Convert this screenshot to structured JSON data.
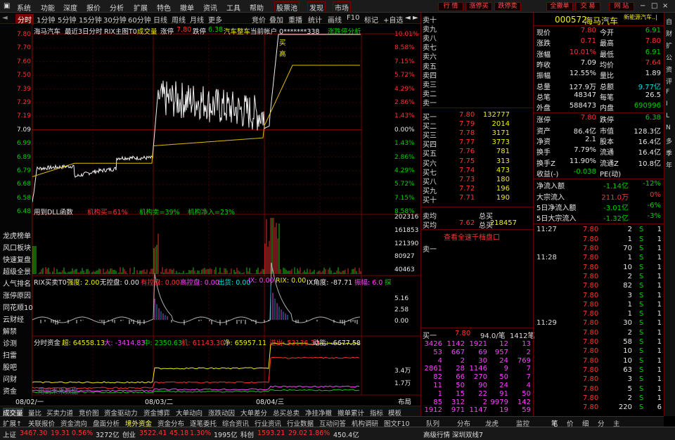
{
  "menu": {
    "items": [
      "系统",
      "功能",
      "深度",
      "报价",
      "分析",
      "扩展",
      "特色",
      "撤单",
      "资讯",
      "工具",
      "帮助"
    ],
    "stock_pool": "股票池",
    "discover": "发现",
    "market": "市场",
    "buttons": [
      "行 情",
      "涨停买",
      "跌停卖",
      "全撤单",
      "交 易",
      "网 站"
    ],
    "win_controls": [
      "−",
      "□",
      "×"
    ]
  },
  "period": {
    "active": "分时",
    "items": [
      "1分钟",
      "5分钟",
      "15分钟",
      "30分钟",
      "60分钟",
      "日线",
      "周线",
      "月线",
      "更多"
    ],
    "right": [
      "竞价",
      "叠加",
      "重播",
      "统计",
      "画线",
      "F10",
      "标记",
      "+自选",
      "◄",
      "►"
    ]
  },
  "chart_header": {
    "name": "海马汽车",
    "desc": "最近3日分时",
    "indicator": "RIX主图T0",
    "vol_label": "成交量",
    "rise_label": "涨停",
    "rise": "7.80",
    "fall_label": "跌停",
    "fall": "6.38",
    "board": "汽车整车",
    "account": "当前帐户 0*******338",
    "analysis": "涨跌停分析"
  },
  "price_axis": [
    "7.80",
    "7.70",
    "7.60",
    "7.50",
    "7.39",
    "7.29",
    "7.19",
    "7.09",
    "6.99",
    "6.89",
    "6.79",
    "6.68",
    "6.58",
    "6.48"
  ],
  "pct_axis": [
    "10.01%",
    "8.58%",
    "7.15%",
    "5.72%",
    "4.29%",
    "2.86%",
    "1.43%",
    "0.00%",
    "1.43%",
    "2.86%",
    "4.29%",
    "5.72%",
    "7.15%",
    "8.58%"
  ],
  "markers": {
    "buy": "买",
    "high": "高"
  },
  "dll": {
    "label": "用到DLL函数",
    "a": "机构买=61%",
    "b": "机构卖=39%",
    "c": "机构净入=23%"
  },
  "vol_axis": [
    "202316",
    "161853",
    "121390",
    "80927",
    "40463"
  ],
  "rix": {
    "label": "RIX买卖T0",
    "strength": "强度: 2.00",
    "no_ctrl": "无控盘: 0.00",
    "ctrl": "有控盘: 0.00",
    "high_ctrl": "高控盘: 0.00",
    "out": "出货: 0.00",
    "ix": "IX: 0.00",
    "rix": "RIX: 0.00",
    "angle": "IX角度: -87.71",
    "amp": "振幅: 6.0",
    "extra": "探"
  },
  "rix_axis": [
    "5.16",
    "2.58",
    "0.00"
  ],
  "fund": {
    "label": "分时资金",
    "super": "超: 64558.13",
    "big": "大: -3414.83",
    "mid": "中: 2350.63",
    "small": "机: 61143.30",
    "net": "净: 65957.11",
    "out": "进出: 53136.30",
    "mom": "动能: -6677.58"
  },
  "fund_axis": [
    "3.4万",
    "1.7万"
  ],
  "watermark": "用到未来数据",
  "dates": [
    "08/02/一",
    "08/03/二",
    "08/04/三"
  ],
  "layout_label": "布局",
  "left_nav": [
    "龙虎榜单",
    "风口板块",
    "快速复盘",
    "超级全景",
    "人气排名",
    "涨停原因",
    "同花顺10",
    "云财经",
    "解禁",
    "诊测",
    "扫雷",
    "股吧",
    "问财",
    "资金"
  ],
  "tabs1": [
    "成交量",
    "量比",
    "买卖力道",
    "竞价图",
    "资金驱动力",
    "资金博弈",
    "大单动向",
    "涨跌动因",
    "大单差分",
    "总买总卖",
    "净挂净撤",
    "撤单累计",
    "指标",
    "模板"
  ],
  "tabs2": [
    "扩展↑",
    "关联报价",
    "资金流向",
    "盘面分析",
    "境外资金",
    "资金分布",
    "逐笔委托",
    "综合资讯",
    "行业资讯",
    "行业数据",
    "互动问答",
    "机构调研",
    "图文F10",
    "侧边栏"
  ],
  "orderbook": {
    "sells": [
      "卖十",
      "卖九",
      "卖八",
      "卖七",
      "卖六",
      "卖五",
      "卖四",
      "卖三",
      "卖二",
      "卖一"
    ],
    "buys": [
      {
        "label": "买一",
        "price": "7.80",
        "vol": "132777"
      },
      {
        "label": "买二",
        "price": "7.79",
        "vol": "2014"
      },
      {
        "label": "买三",
        "price": "7.78",
        "vol": "3171"
      },
      {
        "label": "买四",
        "price": "7.77",
        "vol": "3773"
      },
      {
        "label": "买五",
        "price": "7.76",
        "vol": "781"
      },
      {
        "label": "买六",
        "price": "7.75",
        "vol": "313"
      },
      {
        "label": "买七",
        "price": "7.74",
        "vol": "473"
      },
      {
        "label": "买八",
        "price": "7.73",
        "vol": "180"
      },
      {
        "label": "买九",
        "price": "7.72",
        "vol": "196"
      },
      {
        "label": "买十",
        "price": "7.71",
        "vol": "190"
      }
    ],
    "avg": "卖均",
    "total": "总买",
    "buy_avg_label": "买均",
    "buy_avg": "7.62",
    "total_buy_label": "总买",
    "total_buy": "218457",
    "view_link": "查看全速千档盘口",
    "sell1": "卖一",
    "buy1": "买一",
    "buy1_price": "7.80",
    "buy1_lot": "94.0/笔",
    "buy1_cnt": "1412笔",
    "queue": [
      [
        "3426",
        "1142",
        "1921",
        "12",
        "13"
      ],
      [
        "53",
        "667",
        "69",
        "957",
        "2"
      ],
      [
        "4",
        "2",
        "30",
        "24",
        "769"
      ],
      [
        "2861",
        "28",
        "1146",
        "9",
        "7"
      ],
      [
        "82",
        "66",
        "270",
        "50",
        "7"
      ],
      [
        "11",
        "50",
        "90",
        "24",
        "4"
      ],
      [
        "1",
        "15",
        "22",
        "91",
        "50"
      ],
      [
        "85",
        "312",
        "2",
        "9979",
        "142"
      ],
      [
        "1912",
        "971",
        "1147",
        "19",
        "59"
      ]
    ]
  },
  "quote": {
    "code": "000572",
    "name": "海马汽车",
    "title_tag": "新能源汽车..|",
    "rows": [
      [
        "现价",
        "7.80",
        "今开",
        "6.91"
      ],
      [
        "涨跌",
        "0.71",
        "最高",
        "7.80"
      ],
      [
        "涨幅",
        "10.01%",
        "最低",
        "6.91"
      ],
      [
        "昨收",
        "7.09",
        "均价",
        "7.64"
      ],
      [
        "振幅",
        "12.55%",
        "量比",
        "1.89"
      ],
      [
        "总量",
        "127.9万",
        "总额",
        "9.77亿"
      ],
      [
        "总笔",
        "48347",
        "每笔",
        "26.5"
      ],
      [
        "外盘",
        "588473",
        "内盘",
        "690996"
      ]
    ],
    "rows2": [
      [
        "涨停",
        "7.80",
        "跌停",
        "6.38"
      ],
      [
        "资产",
        "86.4亿",
        "市值",
        "128.3亿"
      ],
      [
        "净资",
        "2.1",
        "股本",
        "16.4亿"
      ],
      [
        "换手",
        "7.79%",
        "流通",
        "16.4亿"
      ],
      [
        "换手Z",
        "11.90%",
        "流通Z",
        "10.8亿"
      ],
      [
        "收益(-)",
        "-0.038",
        "PE(动)",
        ""
      ]
    ],
    "flows": [
      [
        "净流入额",
        "-1.14亿",
        "-12%"
      ],
      [
        "大宗流入",
        "211.0万",
        "0%"
      ],
      [
        "5日净流入额",
        "-3.01亿",
        "-6%"
      ],
      [
        "5日大宗流入",
        "-1.32亿",
        "-3%"
      ]
    ]
  },
  "ticks": [
    {
      "t": "11:27",
      "p": "7.80",
      "v": "2",
      "s": "S",
      "n": "1"
    },
    {
      "t": "",
      "p": "7.80",
      "v": "1",
      "s": "S",
      "n": "1"
    },
    {
      "t": "",
      "p": "7.80",
      "v": "70",
      "s": "S",
      "n": "1"
    },
    {
      "t": "11:28",
      "p": "7.80",
      "v": "1",
      "s": "S",
      "n": "1"
    },
    {
      "t": "",
      "p": "7.80",
      "v": "10",
      "s": "S",
      "n": "1"
    },
    {
      "t": "",
      "p": "7.80",
      "v": "2",
      "s": "S",
      "n": "1"
    },
    {
      "t": "",
      "p": "7.80",
      "v": "82",
      "s": "S",
      "n": "1"
    },
    {
      "t": "",
      "p": "7.80",
      "v": "3",
      "s": "S",
      "n": "1"
    },
    {
      "t": "",
      "p": "7.80",
      "v": "1",
      "s": "S",
      "n": "1"
    },
    {
      "t": "",
      "p": "7.80",
      "v": "1",
      "s": "S",
      "n": "1"
    },
    {
      "t": "11:29",
      "p": "7.80",
      "v": "30",
      "s": "S",
      "n": "1"
    },
    {
      "t": "",
      "p": "7.80",
      "v": "2",
      "s": "S",
      "n": "1"
    },
    {
      "t": "",
      "p": "7.80",
      "v": "58",
      "s": "S",
      "n": "1"
    },
    {
      "t": "",
      "p": "7.80",
      "v": "10",
      "s": "S",
      "n": "1"
    },
    {
      "t": "",
      "p": "7.80",
      "v": "10",
      "s": "S",
      "n": "1"
    },
    {
      "t": "",
      "p": "7.80",
      "v": "63",
      "s": "S",
      "n": "1"
    },
    {
      "t": "",
      "p": "7.80",
      "v": "3",
      "s": "S",
      "n": "1"
    },
    {
      "t": "",
      "p": "7.80",
      "v": "5",
      "s": "S",
      "n": "1"
    },
    {
      "t": "",
      "p": "7.80",
      "v": "2",
      "s": "S",
      "n": "1"
    },
    {
      "t": "",
      "p": "7.80",
      "v": "220",
      "s": "S",
      "n": "6"
    }
  ],
  "rtabs": [
    "队列",
    "分布",
    "龙虎",
    "监控",
    "笔",
    "价",
    "细",
    "分",
    "主"
  ],
  "vtabs": [
    "自",
    "财",
    "扩",
    "公",
    "资",
    "评",
    "F",
    "I",
    "L",
    "N",
    "多",
    "季",
    "年"
  ],
  "status": {
    "idx1": "上证",
    "v1": "3467.30",
    "c1": "19.31",
    "p1": "0.56%",
    "a1": "3272亿",
    "idx2": "创业",
    "v2": "3522.41",
    "c2": "45.18",
    "p2": "1.30%",
    "a2": "1995亿",
    "idx3": "科创",
    "v3": "1593.21",
    "c3": "29.02",
    "p3": "1.86%",
    "a3": "450.4亿",
    "right1": "高级行情",
    "right2": "深圳双线7"
  },
  "chart_data": [
    {
      "type": "line",
      "name": "price",
      "yref": 7.09,
      "ylim": [
        6.48,
        7.8
      ],
      "description": "3-day intraday price"
    },
    {
      "type": "bar",
      "name": "volume",
      "ylim": [
        0,
        202316
      ]
    }
  ]
}
